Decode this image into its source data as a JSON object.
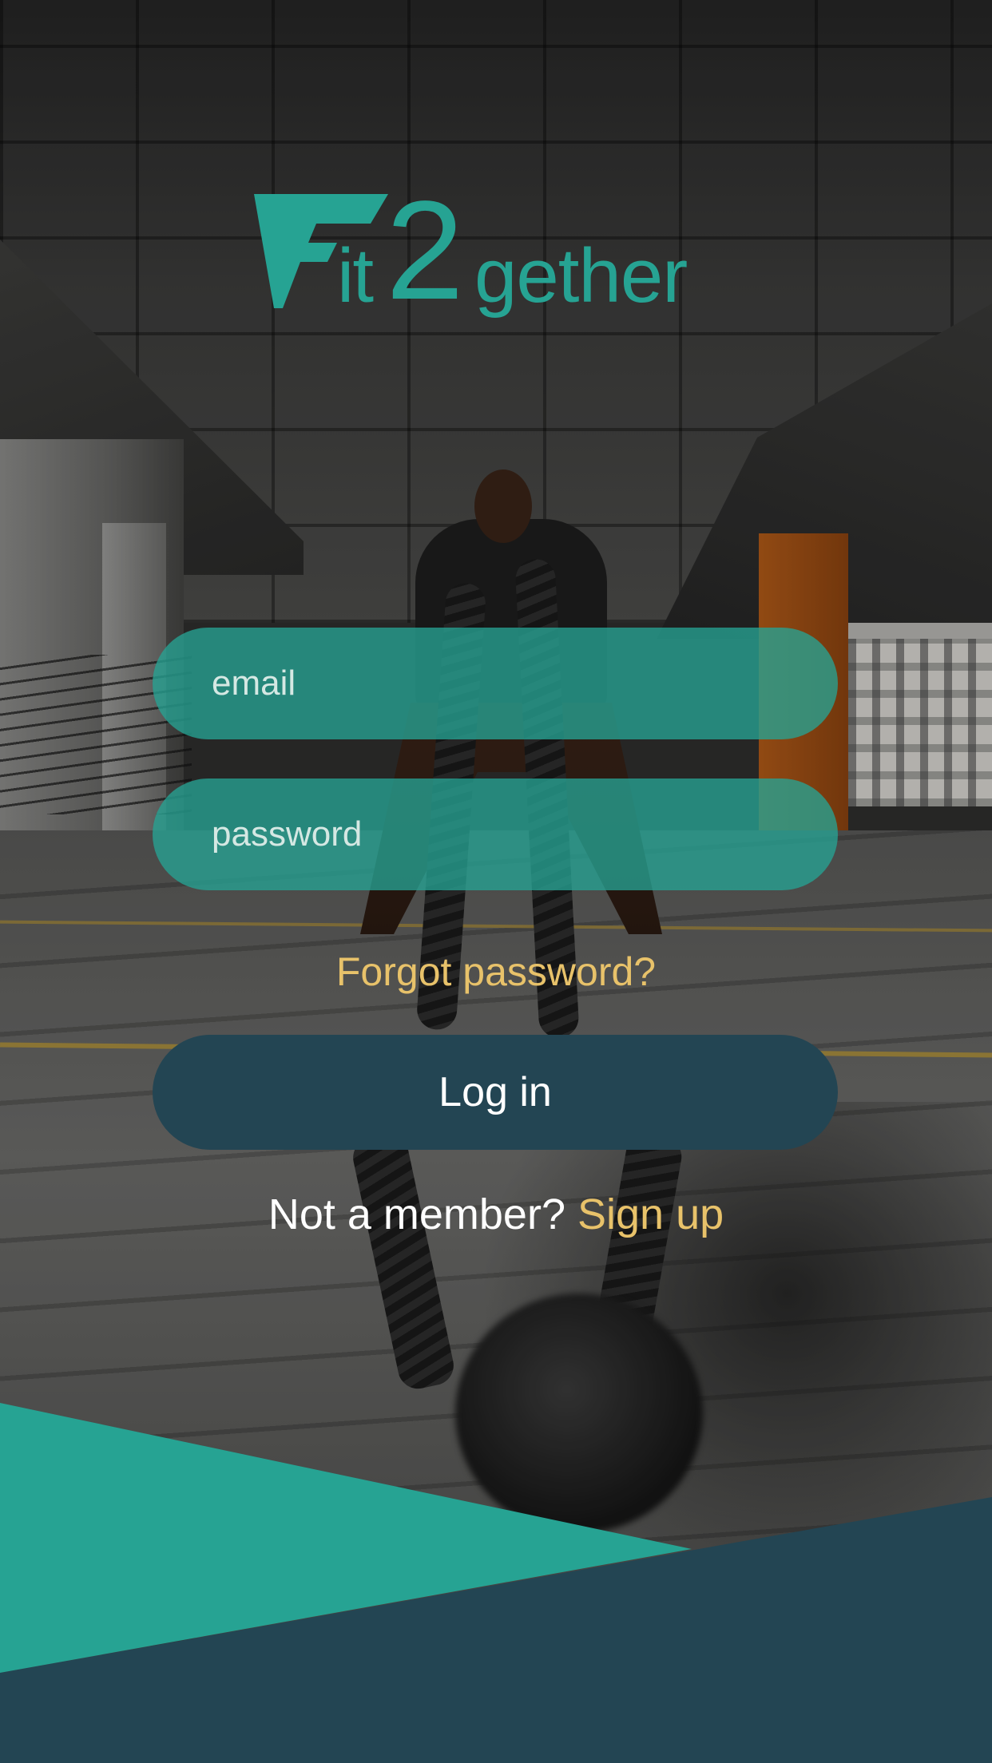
{
  "app": {
    "logo": {
      "part1": "it",
      "part2": "2",
      "part3": "gether",
      "alt": "Fit2gether"
    }
  },
  "form": {
    "email_placeholder": "email",
    "password_placeholder": "password",
    "forgot_label": "Forgot password?",
    "login_label": "Log in"
  },
  "signup": {
    "prompt": "Not a member?",
    "link_label": "Sign up"
  },
  "colors": {
    "brand_teal": "#26a393",
    "dark_navy": "#234553",
    "accent_gold": "#e8c26a"
  },
  "icons": [
    "fit2gether-logo-icon"
  ]
}
